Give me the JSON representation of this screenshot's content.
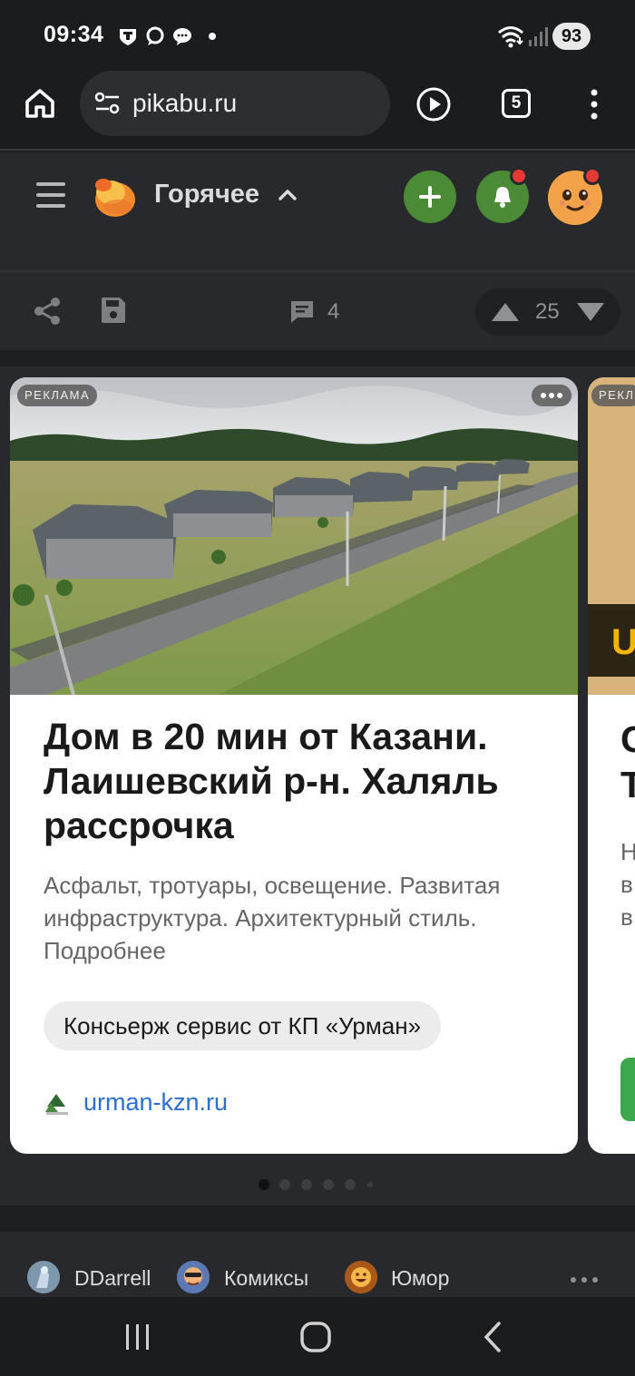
{
  "status_bar": {
    "time": "09:34",
    "battery": "93",
    "icons": [
      "shield-notification-icon",
      "chat-bubble-icon",
      "message-icon",
      "dot-icon",
      "wifi-icon",
      "signal-icon"
    ]
  },
  "browser": {
    "url": "pikabu.ru",
    "tab_count": "5",
    "icons": [
      "home-icon",
      "site-settings-icon",
      "play-icon",
      "tabs-icon",
      "more-vertical-icon"
    ]
  },
  "header": {
    "title": "Горячее",
    "icons": [
      "menu-icon",
      "pikabu-logo",
      "chevron-up-icon",
      "add-icon",
      "bell-icon",
      "avatar"
    ],
    "colors": {
      "add_button": "#4c8b35",
      "bell_button": "#4c8b35",
      "notification_dot": "#e53935"
    }
  },
  "post_actions": {
    "comments": "4",
    "rating": "25",
    "icons": [
      "share-icon",
      "save-icon",
      "comment-icon",
      "upvote-icon",
      "downvote-icon"
    ]
  },
  "ad": {
    "badge": "РЕКЛАМА",
    "title": "Дом в 20 мин от Казани. Лаишевский р-н. Халяль рассрочка",
    "description": "Асфальт, тротуары, освещение. Развитая инфраструктура. Архитектурный стиль. Подробнее",
    "chip": "Консьерж сервис от КП «Урман»",
    "domain": "urman-kzn.ru",
    "next_badge": "РЕКЛ",
    "next_title_fragment": [
      "С",
      "Т"
    ],
    "next_desc_fragment": [
      "Н",
      "в",
      "в"
    ],
    "pager_count": 6,
    "pager_active": 0
  },
  "tags": [
    {
      "label": "DDarrell"
    },
    {
      "label": "Комиксы"
    },
    {
      "label": "Юмор"
    }
  ]
}
